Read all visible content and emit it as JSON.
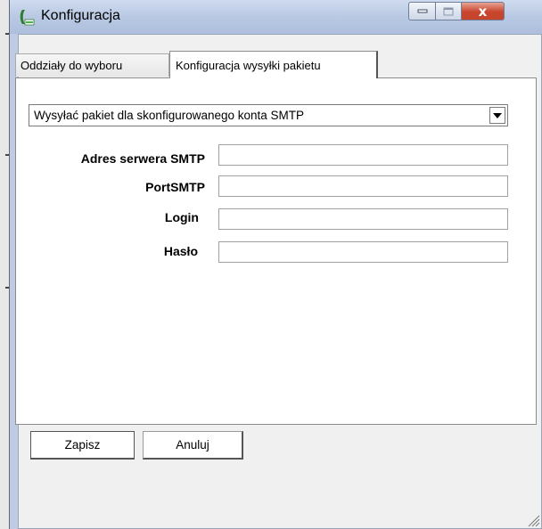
{
  "window": {
    "title": "Konfiguracja"
  },
  "title_bar_buttons": {
    "minimize_icon": "minimize-icon",
    "maximize_icon": "maximize-icon",
    "close_label": "x"
  },
  "tabs": [
    {
      "label": "Oddziały do wyboru",
      "active": false
    },
    {
      "label": "Konfiguracja wysyłki pakietu",
      "active": true
    }
  ],
  "smtp_mode": {
    "selected": "Wysyłać pakiet dla skonfigurowanego konta SMTP",
    "icon": "chevron-down-icon"
  },
  "form": {
    "server_label": "Adres serwera SMTP",
    "server_value": "",
    "port_label": "PortSMTP",
    "port_value": "",
    "login_label": "Login",
    "login_value": "",
    "password_label": "Hasło",
    "password_value": ""
  },
  "actions": {
    "save_label": "Zapisz",
    "cancel_label": "Anuluj"
  },
  "colors": {
    "titlebar": "#b9c9e3",
    "close_button": "#c8452d",
    "client_background": "#f0f0f0",
    "panel_background": "#ffffff"
  }
}
